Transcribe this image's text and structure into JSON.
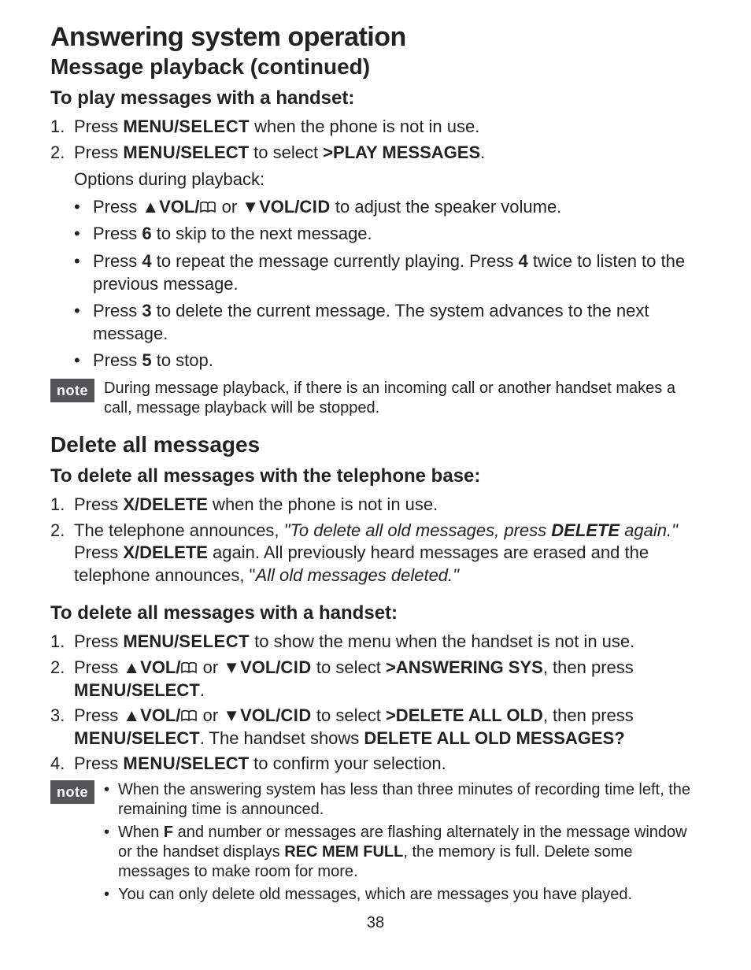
{
  "title": "Answering system operation",
  "subtitle": "Message playback (continued)",
  "play_handset": {
    "heading": "To play messages with a handset:",
    "step1_a": "Press ",
    "step1_b": "MENU/",
    "step1_c": "SELECT",
    "step1_d": " when the phone is not in use.",
    "step2_a": "Press ",
    "step2_b": "MENU",
    "step2_c": "/SELECT",
    "step2_d": " to select ",
    "step2_e": ">PLAY MESSAGES",
    "step2_f": ".",
    "options_label": "Options during playback:",
    "opt1_a": "Press ",
    "opt1_b": "VOL/",
    "opt1_c": " or ",
    "opt1_d": "VOL/",
    "opt1_e": "CID",
    "opt1_f": " to adjust the speaker volume.",
    "opt2_a": "Press ",
    "opt2_b": "6",
    "opt2_c": " to skip to the next message.",
    "opt3_a": "Press ",
    "opt3_b": "4",
    "opt3_c": " to repeat the message currently playing. Press ",
    "opt3_d": "4",
    "opt3_e": " twice to listen to the previous message.",
    "opt4_a": "Press ",
    "opt4_b": "3",
    "opt4_c": " to delete the current message. The system advances to the next message.",
    "opt5_a": "Press ",
    "opt5_b": "5",
    "opt5_c": " to stop."
  },
  "note1": {
    "badge": "note",
    "text": "During message playback, if there is an incoming call or another handset makes a call, message playback will be stopped."
  },
  "delete_all": {
    "heading": "Delete all messages",
    "base": {
      "heading": "To delete all messages with the telephone base:",
      "step1_a": "Press ",
      "step1_b": "X/DELETE",
      "step1_c": " when the phone is not in use.",
      "step2_a": "The telephone announces, ",
      "step2_b": "\"To delete all old messages, press ",
      "step2_c": "DELETE",
      "step2_d": " again.\"",
      "step2_e": " Press ",
      "step2_f": "X/DELETE",
      "step2_g": " again. All previously heard messages are erased and the telephone announces, \"",
      "step2_h": "All old messages deleted.\""
    },
    "handset": {
      "heading": "To delete all messages with a handset:",
      "step1_a": "Press ",
      "step1_b": "MENU/",
      "step1_c": "SELECT",
      "step1_d": " to show the menu when the handset is not in use.",
      "step2_a": "Press ",
      "step2_b": "VOL/",
      "step2_c": " or ",
      "step2_d": "VOL/",
      "step2_e": "CID",
      "step2_f": " to select ",
      "step2_g": ">ANSWERING SYS",
      "step2_h": ", then press ",
      "step2_i": "MENU",
      "step2_j": "/SELECT",
      "step2_k": ".",
      "step3_a": "Press ",
      "step3_b": "VOL/",
      "step3_c": " or ",
      "step3_d": "VOL/",
      "step3_e": "CID",
      "step3_f": " to select ",
      "step3_g": ">DELETE ALL OLD",
      "step3_h": ", then press ",
      "step3_i": "MENU",
      "step3_j": "/SELECT",
      "step3_k": ". The handset shows ",
      "step3_l": "DELETE ALL OLD MESSAGES?",
      "step4_a": "Press ",
      "step4_b": "MENU",
      "step4_c": "/SELECT",
      "step4_d": " to confirm your selection."
    }
  },
  "note2": {
    "badge": "note",
    "b1_a": "When the answering system has less than three minutes of recording time left, the remaining time is announced.",
    "b2_a": "When ",
    "b2_b": "F",
    "b2_c": " and number or messages are flashing alternately in the message window or the handset displays ",
    "b2_d": "REC MEM FULL",
    "b2_e": ", the memory is full. Delete some messages to make room for more.",
    "b3_a": "You can only delete old messages, which are messages you have played."
  },
  "pagenum": "38"
}
